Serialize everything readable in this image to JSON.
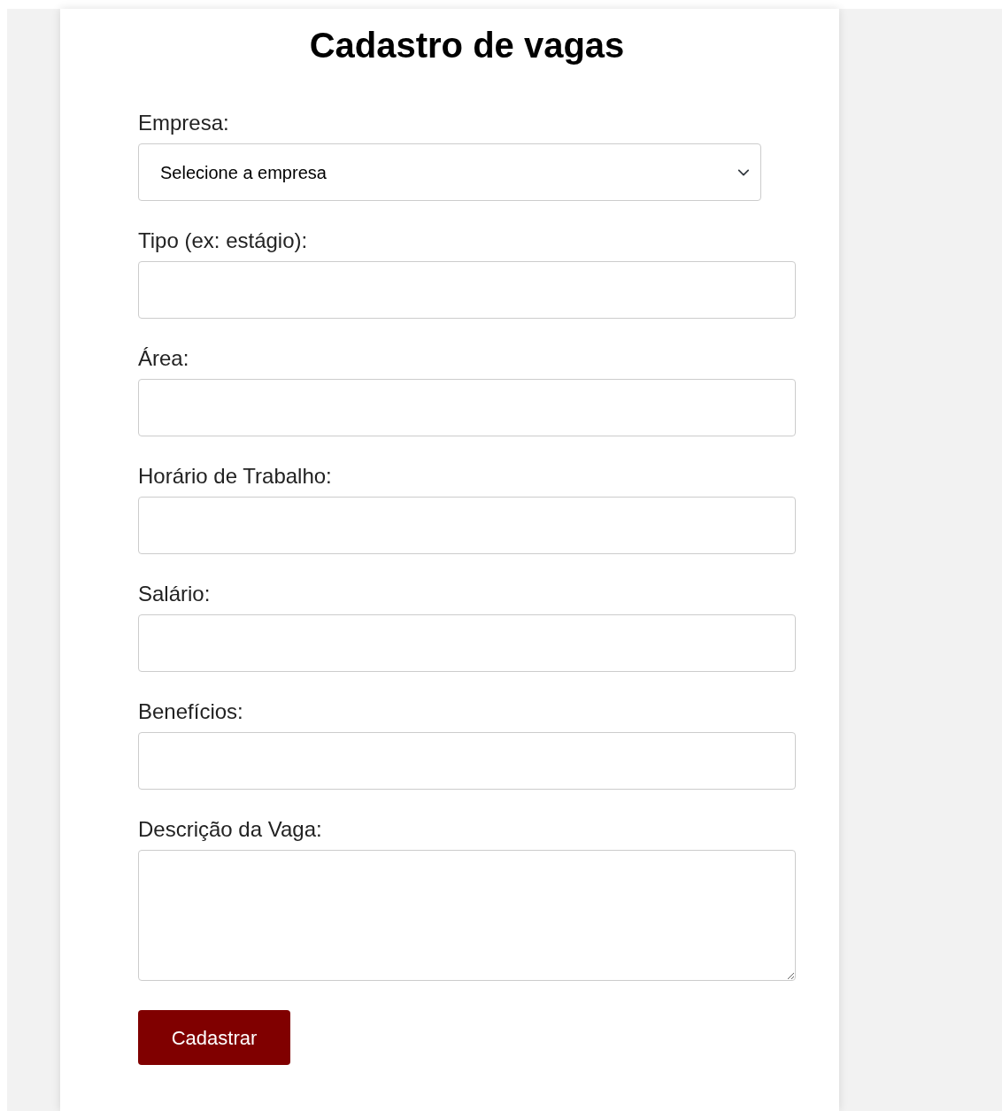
{
  "title": "Cadastro de vagas",
  "fields": [
    {
      "kind": "select",
      "label": "Empresa:",
      "value": "Selecione a empresa"
    },
    {
      "kind": "input",
      "label": "Tipo (ex: estágio):"
    },
    {
      "kind": "input",
      "label": "Área:"
    },
    {
      "kind": "input",
      "label": "Horário de Trabalho:"
    },
    {
      "kind": "input",
      "label": "Salário:"
    },
    {
      "kind": "input",
      "label": "Benefícios:"
    },
    {
      "kind": "textarea",
      "label": "Descrição da Vaga:"
    }
  ],
  "submit_button": "Cadastrar"
}
